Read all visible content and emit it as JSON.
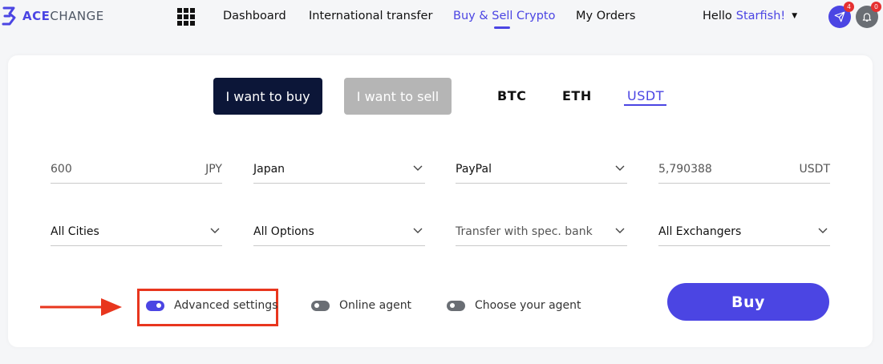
{
  "header": {
    "logo_ace": "ACE",
    "logo_change": "CHANGE",
    "nav": [
      {
        "label": "Dashboard"
      },
      {
        "label": "International transfer"
      },
      {
        "label": "Buy & Sell Crypto"
      },
      {
        "label": "My Orders"
      }
    ],
    "greeting": "Hello",
    "username": "Starfish!",
    "send_badge": "4",
    "bell_badge": "0"
  },
  "mode": {
    "buy_label": "I want to buy",
    "sell_label": "I want to sell"
  },
  "coins": [
    "BTC",
    "ETH",
    "USDT"
  ],
  "row1": {
    "amount": "600",
    "amount_unit": "JPY",
    "country": "Japan",
    "payment": "PayPal",
    "receive": "5,790388",
    "receive_unit": "USDT"
  },
  "row2": {
    "cities": "All Cities",
    "options": "All Options",
    "bank_placeholder": "Transfer with spec. bank",
    "exchangers": "All Exchangers"
  },
  "toggles": [
    {
      "label": "Advanced settings",
      "on": true
    },
    {
      "label": "Online agent",
      "on": false
    },
    {
      "label": "Choose your agent",
      "on": false
    }
  ],
  "buy_button": "Buy",
  "colors": {
    "accent": "#4b45e3",
    "dark_button": "#0c1638",
    "disabled_button": "#b5b5b5",
    "highlight": "#e8361e"
  }
}
